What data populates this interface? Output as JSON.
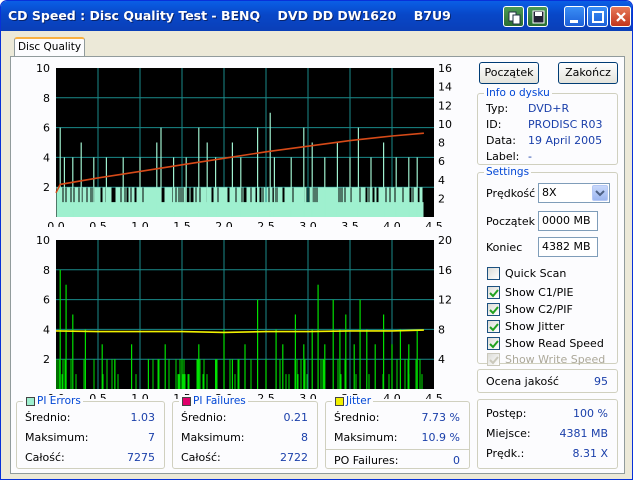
{
  "window": {
    "title": "CD Speed : Disc Quality Test - BENQ    DVD DD DW1620    B7U9"
  },
  "tabs": [
    {
      "label": "Disc Quality"
    }
  ],
  "buttons": {
    "start": "Początek",
    "exit": "Zakończ"
  },
  "disc_info": {
    "title": "Info o dysku",
    "rows": [
      {
        "label": "Typ:",
        "value": "DVD+R"
      },
      {
        "label": "ID:",
        "value": "PRODISC R03"
      },
      {
        "label": "Data:",
        "value": "19 April 2005"
      },
      {
        "label": "Label:",
        "value": "-"
      }
    ]
  },
  "settings": {
    "title": "Settings",
    "speed_label": "Prędkość",
    "speed_value": "8X",
    "start_label": "Początek",
    "start_value": "0000 MB",
    "end_label": "Koniec",
    "end_value": "4382 MB",
    "checks": [
      {
        "label": "Quick Scan",
        "checked": false,
        "disabled": false
      },
      {
        "label": "Show C1/PIE",
        "checked": true,
        "disabled": false
      },
      {
        "label": "Show C2/PIF",
        "checked": true,
        "disabled": false
      },
      {
        "label": "Show Jitter",
        "checked": true,
        "disabled": false
      },
      {
        "label": "Show Read Speed",
        "checked": true,
        "disabled": false
      },
      {
        "label": "Show Write Speed",
        "checked": true,
        "disabled": true
      }
    ]
  },
  "quality": {
    "label": "Ocena jakość",
    "value": "95"
  },
  "progress": {
    "rows": [
      {
        "label": "Postęp:",
        "value": "100 %"
      },
      {
        "label": "Miejsce:",
        "value": "4381 MB"
      },
      {
        "label": "Prędk.:",
        "value": "8.31 X"
      }
    ]
  },
  "stats": {
    "pi_errors": {
      "title": "PI Errors",
      "color": "#9ff0cf",
      "rows": [
        {
          "label": "Średnio:",
          "value": "1.03"
        },
        {
          "label": "Maksimum:",
          "value": "7"
        },
        {
          "label": "Całość:",
          "value": "7275"
        }
      ]
    },
    "pi_failures": {
      "title": "PI Failures",
      "color": "#e0006a",
      "rows": [
        {
          "label": "Średnio:",
          "value": "0.21"
        },
        {
          "label": "Maksimum:",
          "value": "8"
        },
        {
          "label": "Całość:",
          "value": "2722"
        }
      ]
    },
    "jitter": {
      "title": "Jitter",
      "color": "#f0f000",
      "rows": [
        {
          "label": "Średnio:",
          "value": "7.73 %"
        },
        {
          "label": "Maksimum:",
          "value": "10.9 %"
        }
      ]
    },
    "po_failures": {
      "label": "PO Failures:",
      "value": "0"
    }
  },
  "chart_data": [
    {
      "type": "bar",
      "xlim": [
        0,
        4.5
      ],
      "ylim_left": [
        0,
        10
      ],
      "ylim_right": [
        0,
        16
      ],
      "x_ticks": [
        "0.0",
        "0.5",
        "1.0",
        "1.5",
        "2.0",
        "2.5",
        "3.0",
        "3.5",
        "4.0",
        "4.5"
      ],
      "y_ticks_left": [
        "2",
        "4",
        "6",
        "8",
        "10"
      ],
      "y_ticks_right": [
        "2",
        "4",
        "6",
        "8",
        "10",
        "12",
        "14",
        "16"
      ],
      "series": [
        {
          "color": "#9ff0cf",
          "x_end": 4.38,
          "typical": 2,
          "baseline": 1,
          "spikes": [
            [
              0.05,
              6
            ],
            [
              0.1,
              4
            ],
            [
              0.2,
              4
            ],
            [
              0.3,
              5
            ],
            [
              0.45,
              4
            ],
            [
              0.6,
              4
            ],
            [
              0.8,
              4
            ],
            [
              1.0,
              4
            ],
            [
              1.2,
              5
            ],
            [
              1.25,
              6
            ],
            [
              1.4,
              4
            ],
            [
              1.55,
              4
            ],
            [
              1.7,
              6
            ],
            [
              1.8,
              5
            ],
            [
              1.9,
              4
            ],
            [
              2.1,
              5
            ],
            [
              2.2,
              4
            ],
            [
              2.4,
              6
            ],
            [
              2.55,
              7
            ],
            [
              2.6,
              4
            ],
            [
              2.8,
              4
            ],
            [
              2.95,
              6
            ],
            [
              3.05,
              5
            ],
            [
              3.2,
              4
            ],
            [
              3.35,
              5
            ],
            [
              3.5,
              4
            ],
            [
              3.6,
              6
            ],
            [
              3.75,
              4
            ],
            [
              3.9,
              5
            ],
            [
              4.05,
              4
            ],
            [
              4.2,
              4
            ],
            [
              4.3,
              4
            ]
          ]
        },
        {
          "color": "#d64a18",
          "axis": "right",
          "points": [
            [
              0.0,
              2.6
            ],
            [
              0.05,
              3.5
            ],
            [
              0.5,
              4.2
            ],
            [
              1.0,
              4.9
            ],
            [
              1.5,
              5.6
            ],
            [
              2.0,
              6.3
            ],
            [
              2.5,
              7.0
            ],
            [
              3.0,
              7.6
            ],
            [
              3.5,
              8.2
            ],
            [
              4.0,
              8.7
            ],
            [
              4.38,
              9.0
            ]
          ]
        }
      ]
    },
    {
      "type": "bar",
      "xlim": [
        0,
        4.5
      ],
      "ylim_left": [
        0,
        10
      ],
      "ylim_right": [
        0,
        20
      ],
      "x_ticks": [
        "0.0",
        "0.5",
        "1.0",
        "1.5",
        "2.0",
        "2.5",
        "3.0",
        "3.5",
        "4.0",
        "4.5"
      ],
      "y_ticks_left": [
        "2",
        "4",
        "6",
        "8",
        "10"
      ],
      "y_ticks_right": [
        "4",
        "8",
        "12",
        "16",
        "20"
      ],
      "series": [
        {
          "color": "#00e000",
          "x_end": 4.38,
          "spikes": [
            [
              0.05,
              8
            ],
            [
              0.12,
              7
            ],
            [
              0.2,
              5
            ],
            [
              0.35,
              4
            ],
            [
              0.55,
              3
            ],
            [
              0.7,
              2
            ],
            [
              0.9,
              3
            ],
            [
              1.1,
              2
            ],
            [
              1.3,
              3
            ],
            [
              1.5,
              2
            ],
            [
              1.7,
              3
            ],
            [
              1.9,
              2
            ],
            [
              2.0,
              4
            ],
            [
              2.1,
              2
            ],
            [
              2.25,
              3
            ],
            [
              2.4,
              6
            ],
            [
              2.5,
              2
            ],
            [
              2.62,
              4
            ],
            [
              2.7,
              3
            ],
            [
              2.85,
              5
            ],
            [
              2.95,
              3
            ],
            [
              3.05,
              4
            ],
            [
              3.12,
              7
            ],
            [
              3.2,
              3
            ],
            [
              3.3,
              6
            ],
            [
              3.38,
              4
            ],
            [
              3.45,
              5
            ],
            [
              3.55,
              3
            ],
            [
              3.62,
              6
            ],
            [
              3.7,
              4
            ],
            [
              3.8,
              3
            ],
            [
              3.9,
              5
            ],
            [
              4.0,
              3
            ],
            [
              4.1,
              4
            ],
            [
              4.2,
              3
            ],
            [
              4.3,
              4
            ]
          ]
        },
        {
          "color": "#f0f000",
          "axis": "right",
          "points": [
            [
              0.0,
              7.8
            ],
            [
              0.5,
              7.7
            ],
            [
              1.0,
              7.7
            ],
            [
              1.5,
              7.7
            ],
            [
              2.0,
              7.6
            ],
            [
              2.5,
              7.7
            ],
            [
              3.0,
              7.7
            ],
            [
              3.5,
              7.8
            ],
            [
              4.0,
              7.8
            ],
            [
              4.38,
              7.9
            ]
          ]
        }
      ]
    }
  ]
}
